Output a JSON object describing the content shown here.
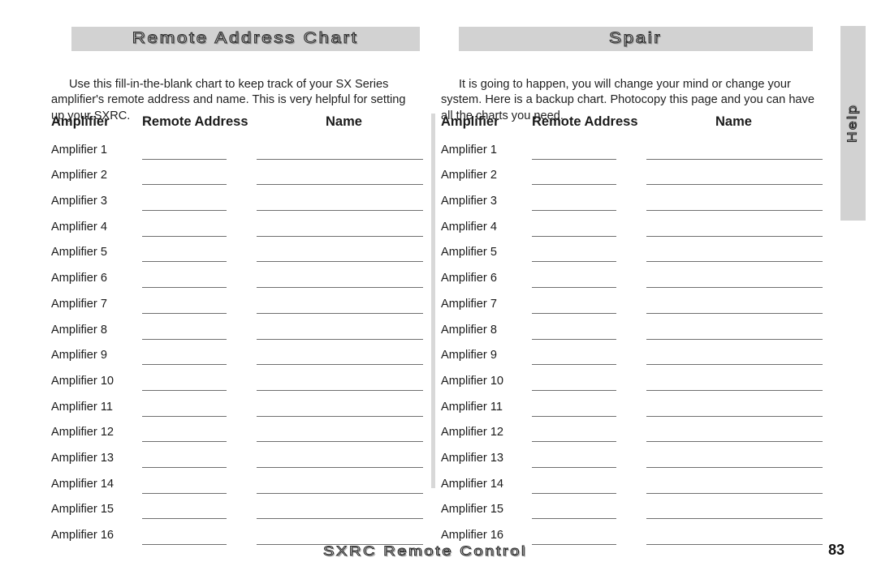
{
  "document": {
    "footer_title": "SXRC Remote Control",
    "page_number": "83",
    "side_tab_label": "Help"
  },
  "left_section": {
    "banner_title": "Remote Address Chart",
    "intro": "Use this fill-in-the-blank chart to keep track of your SX Series amplifier's remote address and name. This is very helpful for setting up your SXRC.",
    "headers": {
      "amplifier": "Amplifier",
      "remote_address": "Remote Address",
      "name": "Name"
    },
    "rows": [
      "Amplifier 1",
      "Amplifier 2",
      "Amplifier 3",
      "Amplifier 4",
      "Amplifier 5",
      "Amplifier 6",
      "Amplifier 7",
      "Amplifier 8",
      "Amplifier 9",
      "Amplifier 10",
      "Amplifier 11",
      "Amplifier 12",
      "Amplifier 13",
      "Amplifier 14",
      "Amplifier 15",
      "Amplifier 16"
    ]
  },
  "right_section": {
    "banner_title": "Spair",
    "intro": "It is going to happen, you will change your mind or change your system. Here is a backup chart. Photocopy this page and you can have all the charts you need.",
    "headers": {
      "amplifier": "Amplifier",
      "remote_address": "Remote Address",
      "name": "Name"
    },
    "rows": [
      "Amplifier 1",
      "Amplifier 2",
      "Amplifier 3",
      "Amplifier 4",
      "Amplifier 5",
      "Amplifier 6",
      "Amplifier 7",
      "Amplifier 8",
      "Amplifier 9",
      "Amplifier 10",
      "Amplifier 11",
      "Amplifier 12",
      "Amplifier 13",
      "Amplifier 14",
      "Amplifier 15",
      "Amplifier 16"
    ]
  },
  "colors": {
    "banner_background": "#d2d2d2",
    "divider": "#d8d8d8",
    "blank_line": "#6f6f6f",
    "text": "#1a1a1a"
  }
}
